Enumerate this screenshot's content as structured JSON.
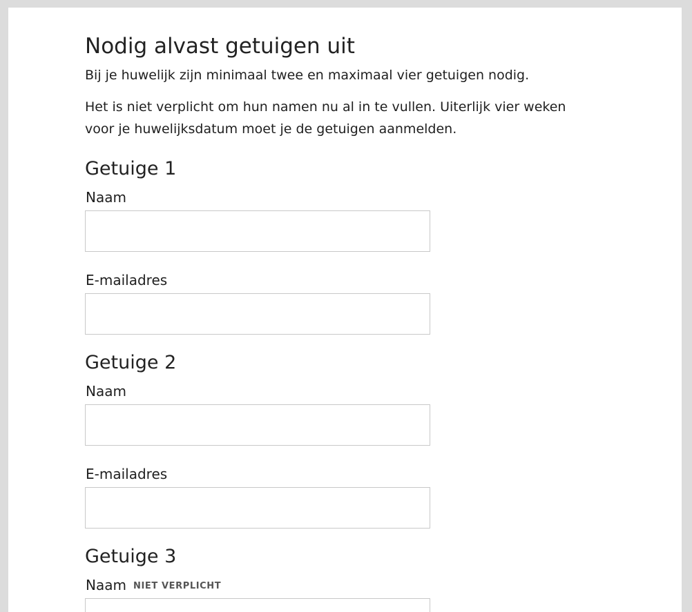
{
  "page": {
    "title": "Nodig alvast getuigen uit",
    "intro_1": "Bij je huwelijk zijn minimaal twee en maximaal vier getuigen nodig.",
    "intro_2": "Het is niet verplicht om hun namen nu al in te vullen. Uiterlijk vier weken voor je huwelijksdatum moet je de getuigen aanmelden."
  },
  "witnesses": [
    {
      "heading": "Getuige 1",
      "name_label": "Naam",
      "name_value": "",
      "email_label": "E-mailadres",
      "email_value": ""
    },
    {
      "heading": "Getuige 2",
      "name_label": "Naam",
      "name_value": "",
      "email_label": "E-mailadres",
      "email_value": ""
    },
    {
      "heading": "Getuige 3",
      "name_label": "Naam",
      "name_optional": "NIET VERPLICHT",
      "name_value": ""
    }
  ],
  "colors": {
    "page_background": "#dcdcdc",
    "panel_background": "#ffffff",
    "input_border": "#c8c8c8",
    "text": "#1f1f1f"
  }
}
